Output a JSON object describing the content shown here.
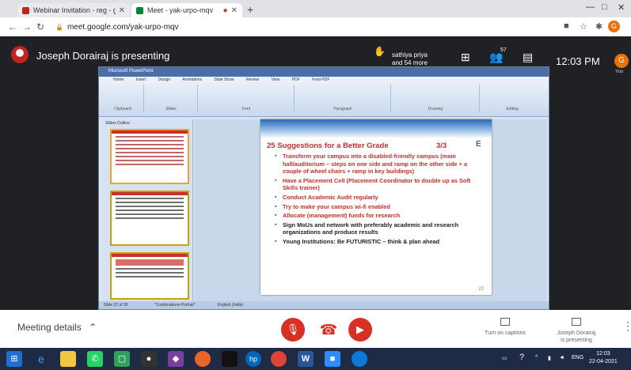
{
  "browser": {
    "tabs": [
      {
        "label": "Webinar Invitation - reg - gugu@...",
        "color": "#c5221f"
      },
      {
        "label": "Meet - yak-urpo-mqv",
        "color": "#00832d"
      }
    ],
    "url": "meet.google.com/yak-urpo-mqv"
  },
  "meet": {
    "presenting_label": "Joseph Dorairaj is presenting",
    "participants_text_line1": "sathiya priya",
    "participants_text_line2": "and 54 more",
    "people_count": "57",
    "time": "12:03 PM",
    "avatar_letter": "G",
    "you_label": "You"
  },
  "powerpoint": {
    "window_title": "Microsoft PowerPoint",
    "ribbon_tabs": [
      "Home",
      "Insert",
      "Design",
      "Animations",
      "Slide Show",
      "Review",
      "View",
      "PDF",
      "Foxit PDF"
    ],
    "ribbon_groups": [
      "Clipboard",
      "Slides",
      "Font",
      "Paragraph",
      "Drawing",
      "Editing"
    ],
    "panel_tabs": "Slides   Outline",
    "status_left": "Slide 22 of 35",
    "status_theme": "\"Combinations Portrait\"",
    "status_lang": "English (India)"
  },
  "slide": {
    "title": "25 Suggestions for a Better Grade",
    "page": "3/3",
    "corner_letter": "E",
    "bullets": [
      {
        "text": "Transform your campus into a disabled-friendly campus (main hall/auditorium – steps on one side and ramp on the other side + a couple of wheel chairs + ramp in key buildings)",
        "color": "#c9302c"
      },
      {
        "text": "Have a Placement Cell (Placement Coordinator to double up as Soft Skills trainer)",
        "color": "#c9302c"
      },
      {
        "text": "Conduct Academic Audit regularly",
        "color": "#c9302c"
      },
      {
        "text": "Try to make your campus wi-fi enabled",
        "color": "#c9302c"
      },
      {
        "text": "Allocate (management) funds for research",
        "color": "#c9302c"
      },
      {
        "text": "Sign MoUs and network with preferably academic and research organizations and produce results",
        "color": "#222222"
      },
      {
        "text": "Young Institutions: Be FUTURISTIC – think & plan ahead",
        "color": "#222222"
      }
    ],
    "number": "22"
  },
  "bottom": {
    "meeting_details": "Meeting details",
    "captions": "Turn on captions",
    "presenter_line1": "Joseph Dorairaj",
    "presenter_line2": "is presenting"
  },
  "taskbar": {
    "lang": "ENG",
    "time": "12:03",
    "date": "22-04-2021"
  }
}
